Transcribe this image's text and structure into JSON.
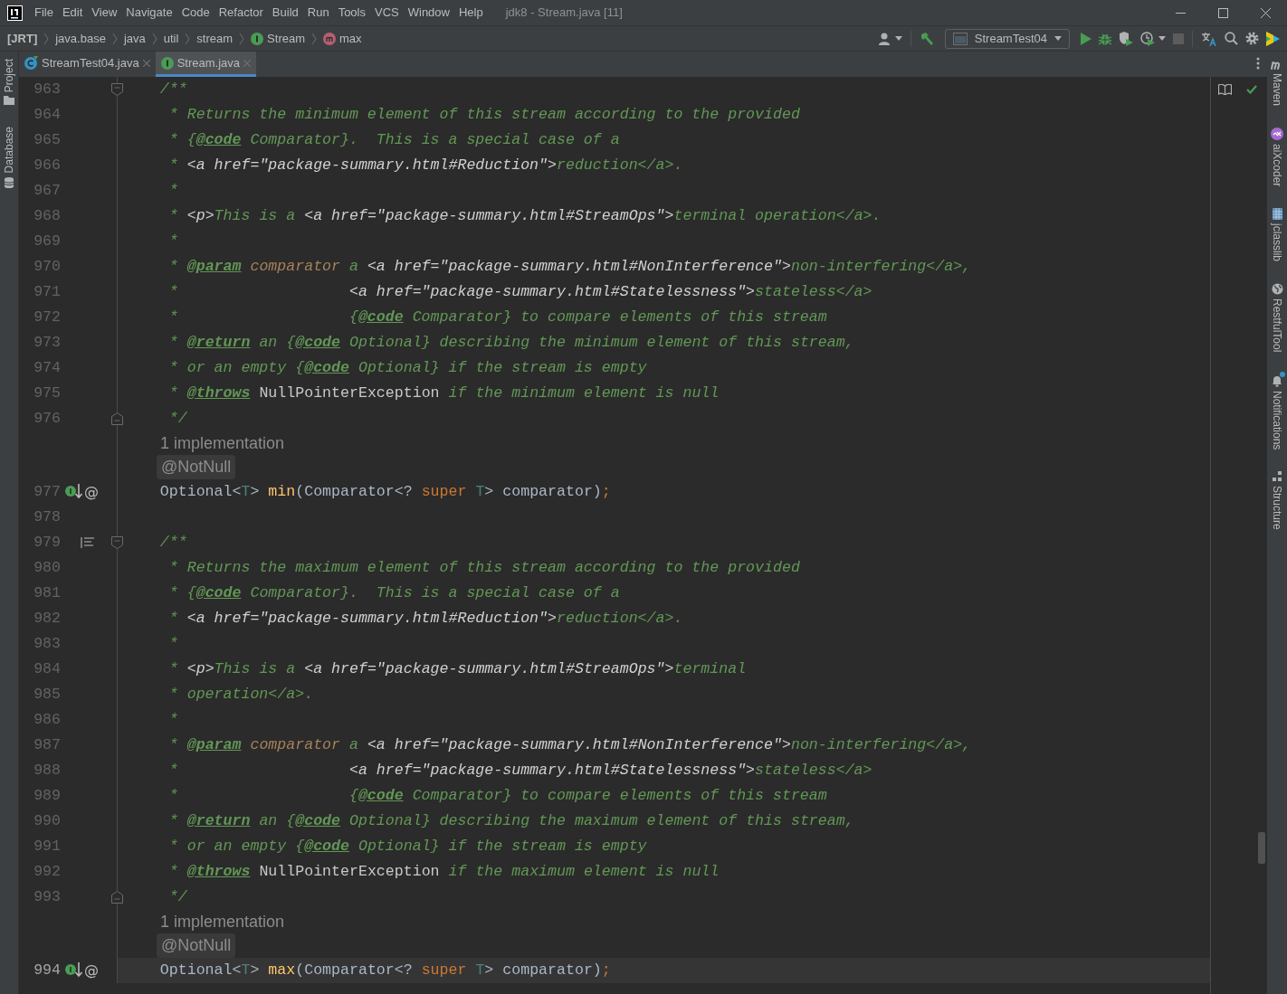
{
  "window": {
    "title": "jdk8 - Stream.java [11]"
  },
  "menu": [
    {
      "label": "File"
    },
    {
      "label": "Edit"
    },
    {
      "label": "View"
    },
    {
      "label": "Navigate"
    },
    {
      "label": "Code"
    },
    {
      "label": "Refactor"
    },
    {
      "label": "Build"
    },
    {
      "label": "Run"
    },
    {
      "label": "Tools"
    },
    {
      "label": "VCS"
    },
    {
      "label": "Window"
    },
    {
      "label": "Help"
    }
  ],
  "breadcrumbs": [
    {
      "label": "[JRT]",
      "kind": "module"
    },
    {
      "label": "java.base",
      "kind": "package"
    },
    {
      "label": "java",
      "kind": "package"
    },
    {
      "label": "util",
      "kind": "package"
    },
    {
      "label": "stream",
      "kind": "package"
    },
    {
      "label": "Stream",
      "kind": "interface"
    },
    {
      "label": "max",
      "kind": "method"
    }
  ],
  "toolbar": {
    "run_configuration": "StreamTest04",
    "stop_disabled": true
  },
  "tabs": [
    {
      "label": "StreamTest04.java",
      "kind": "class",
      "selected": false
    },
    {
      "label": "Stream.java",
      "kind": "interface",
      "selected": true
    }
  ],
  "left_tools": [
    {
      "label": "Project",
      "kind": "folder"
    },
    {
      "label": "Database",
      "kind": "database"
    }
  ],
  "right_tools": [
    {
      "label": "Maven",
      "kind": "maven",
      "badge": false
    },
    {
      "label": "aiXcoder",
      "kind": "plugin",
      "badge": false
    },
    {
      "label": "jclasslib",
      "kind": "grid",
      "badge": false
    },
    {
      "label": "RestfulTool",
      "kind": "globe",
      "badge": false
    },
    {
      "label": "Notifications",
      "kind": "bell",
      "badge": true
    },
    {
      "label": "Structure",
      "kind": "structure",
      "badge": false
    }
  ],
  "editor": {
    "rows": [
      {
        "kind": "code",
        "number": "963",
        "fold": {
          "kind": "start"
        },
        "current": false,
        "tokens": [
          {
            "kind": "doc",
            "text": "    /**"
          }
        ]
      },
      {
        "kind": "code",
        "number": "964",
        "current": false,
        "tokens": [
          {
            "kind": "doc",
            "text": "     * Returns the minimum element of this stream according to the provided"
          }
        ]
      },
      {
        "kind": "code",
        "number": "965",
        "current": false,
        "tokens": [
          {
            "kind": "doc",
            "text": "     * {"
          },
          {
            "kind": "tag",
            "text": "@code"
          },
          {
            "kind": "doc",
            "text": " Comparator}.  This is a special case of a"
          }
        ]
      },
      {
        "kind": "code",
        "number": "966",
        "current": false,
        "tokens": [
          {
            "kind": "doc",
            "text": "     * "
          },
          {
            "kind": "markup",
            "text": "<a href=\"package-summary.html#Reduction\">"
          },
          {
            "kind": "doc",
            "text": "reduction</a>."
          }
        ]
      },
      {
        "kind": "code",
        "number": "967",
        "current": false,
        "tokens": [
          {
            "kind": "doc",
            "text": "     *"
          }
        ]
      },
      {
        "kind": "code",
        "number": "968",
        "current": false,
        "tokens": [
          {
            "kind": "doc",
            "text": "     * "
          },
          {
            "kind": "markup",
            "text": "<p>"
          },
          {
            "kind": "doc",
            "text": "This is a "
          },
          {
            "kind": "markup",
            "text": "<a href=\"package-summary.html#StreamOps\">"
          },
          {
            "kind": "doc",
            "text": "terminal operation</a>."
          }
        ]
      },
      {
        "kind": "code",
        "number": "969",
        "current": false,
        "tokens": [
          {
            "kind": "doc",
            "text": "     *"
          }
        ]
      },
      {
        "kind": "code",
        "number": "970",
        "current": false,
        "tokens": [
          {
            "kind": "doc",
            "text": "     * "
          },
          {
            "kind": "tag",
            "text": "@param"
          },
          {
            "kind": "param",
            "text": " comparator"
          },
          {
            "kind": "doc",
            "text": " a "
          },
          {
            "kind": "markup",
            "text": "<a href=\"package-summary.html#NonInterference\">"
          },
          {
            "kind": "doc",
            "text": "non-interfering</a>,"
          }
        ]
      },
      {
        "kind": "code",
        "number": "971",
        "current": false,
        "tokens": [
          {
            "kind": "doc",
            "text": "     *                   "
          },
          {
            "kind": "markup",
            "text": "<a href=\"package-summary.html#Statelessness\">"
          },
          {
            "kind": "doc",
            "text": "stateless</a>"
          }
        ]
      },
      {
        "kind": "code",
        "number": "972",
        "current": false,
        "tokens": [
          {
            "kind": "doc",
            "text": "     *                   {"
          },
          {
            "kind": "tag",
            "text": "@code"
          },
          {
            "kind": "doc",
            "text": " Comparator} to compare elements of this stream"
          }
        ]
      },
      {
        "kind": "code",
        "number": "973",
        "current": false,
        "tokens": [
          {
            "kind": "doc",
            "text": "     * "
          },
          {
            "kind": "tag",
            "text": "@return"
          },
          {
            "kind": "doc",
            "text": " an {"
          },
          {
            "kind": "tag",
            "text": "@code"
          },
          {
            "kind": "doc",
            "text": " Optional} describing the minimum element of this stream,"
          }
        ]
      },
      {
        "kind": "code",
        "number": "974",
        "current": false,
        "tokens": [
          {
            "kind": "doc",
            "text": "     * or an empty {"
          },
          {
            "kind": "tag",
            "text": "@code"
          },
          {
            "kind": "doc",
            "text": " Optional} if the stream is empty"
          }
        ]
      },
      {
        "kind": "code",
        "number": "975",
        "current": false,
        "tokens": [
          {
            "kind": "doc",
            "text": "     * "
          },
          {
            "kind": "tag",
            "text": "@throws"
          },
          {
            "kind": "ref",
            "text": " NullPointerException"
          },
          {
            "kind": "doc",
            "text": " if the minimum element is null"
          }
        ]
      },
      {
        "kind": "code",
        "number": "976",
        "fold": {
          "kind": "end"
        },
        "current": false,
        "tokens": [
          {
            "kind": "doc",
            "text": "     */"
          }
        ]
      },
      {
        "kind": "hint",
        "text": "1 implementation"
      },
      {
        "kind": "annotation",
        "text": "@NotNull"
      },
      {
        "kind": "code",
        "number": "977",
        "current": false,
        "marks": [
          {
            "kind": "implemented"
          }
        ],
        "annotation_mark": "@",
        "tokens": [
          {
            "kind": "plain",
            "text": "    Optional<"
          },
          {
            "kind": "type",
            "text": "T"
          },
          {
            "kind": "plain",
            "text": "> "
          },
          {
            "kind": "method",
            "text": "min"
          },
          {
            "kind": "plain",
            "text": "(Comparator<? "
          },
          {
            "kind": "keyword",
            "text": "super"
          },
          {
            "kind": "type",
            "text": " T"
          },
          {
            "kind": "plain",
            "text": "> comparator)"
          },
          {
            "kind": "keyword",
            "text": ";"
          }
        ]
      },
      {
        "kind": "code",
        "number": "978",
        "current": false
      },
      {
        "kind": "code",
        "number": "979",
        "fold": {
          "kind": "start"
        },
        "current": false,
        "marks": [
          {
            "kind": "render_doc"
          }
        ],
        "tokens": [
          {
            "kind": "doc",
            "text": "    /**"
          }
        ]
      },
      {
        "kind": "code",
        "number": "980",
        "current": false,
        "tokens": [
          {
            "kind": "doc",
            "text": "     * Returns the maximum element of this stream according to the provided"
          }
        ]
      },
      {
        "kind": "code",
        "number": "981",
        "current": false,
        "tokens": [
          {
            "kind": "doc",
            "text": "     * {"
          },
          {
            "kind": "tag",
            "text": "@code"
          },
          {
            "kind": "doc",
            "text": " Comparator}.  This is a special case of a"
          }
        ]
      },
      {
        "kind": "code",
        "number": "982",
        "current": false,
        "tokens": [
          {
            "kind": "doc",
            "text": "     * "
          },
          {
            "kind": "markup",
            "text": "<a href=\"package-summary.html#Reduction\">"
          },
          {
            "kind": "doc",
            "text": "reduction</a>."
          }
        ]
      },
      {
        "kind": "code",
        "number": "983",
        "current": false,
        "tokens": [
          {
            "kind": "doc",
            "text": "     *"
          }
        ]
      },
      {
        "kind": "code",
        "number": "984",
        "current": false,
        "tokens": [
          {
            "kind": "doc",
            "text": "     * "
          },
          {
            "kind": "markup",
            "text": "<p>"
          },
          {
            "kind": "doc",
            "text": "This is a "
          },
          {
            "kind": "markup",
            "text": "<a href=\"package-summary.html#StreamOps\">"
          },
          {
            "kind": "doc",
            "text": "terminal"
          }
        ]
      },
      {
        "kind": "code",
        "number": "985",
        "current": false,
        "tokens": [
          {
            "kind": "doc",
            "text": "     * operation</a>."
          }
        ]
      },
      {
        "kind": "code",
        "number": "986",
        "current": false,
        "tokens": [
          {
            "kind": "doc",
            "text": "     *"
          }
        ]
      },
      {
        "kind": "code",
        "number": "987",
        "current": false,
        "tokens": [
          {
            "kind": "doc",
            "text": "     * "
          },
          {
            "kind": "tag",
            "text": "@param"
          },
          {
            "kind": "param",
            "text": " comparator"
          },
          {
            "kind": "doc",
            "text": " a "
          },
          {
            "kind": "markup",
            "text": "<a href=\"package-summary.html#NonInterference\">"
          },
          {
            "kind": "doc",
            "text": "non-interfering</a>,"
          }
        ]
      },
      {
        "kind": "code",
        "number": "988",
        "current": false,
        "tokens": [
          {
            "kind": "doc",
            "text": "     *                   "
          },
          {
            "kind": "markup",
            "text": "<a href=\"package-summary.html#Statelessness\">"
          },
          {
            "kind": "doc",
            "text": "stateless</a>"
          }
        ]
      },
      {
        "kind": "code",
        "number": "989",
        "current": false,
        "tokens": [
          {
            "kind": "doc",
            "text": "     *                   {"
          },
          {
            "kind": "tag",
            "text": "@code"
          },
          {
            "kind": "doc",
            "text": " Comparator} to compare elements of this stream"
          }
        ]
      },
      {
        "kind": "code",
        "number": "990",
        "current": false,
        "tokens": [
          {
            "kind": "doc",
            "text": "     * "
          },
          {
            "kind": "tag",
            "text": "@return"
          },
          {
            "kind": "doc",
            "text": " an {"
          },
          {
            "kind": "tag",
            "text": "@code"
          },
          {
            "kind": "doc",
            "text": " Optional} describing the maximum element of this stream,"
          }
        ]
      },
      {
        "kind": "code",
        "number": "991",
        "current": false,
        "tokens": [
          {
            "kind": "doc",
            "text": "     * or an empty {"
          },
          {
            "kind": "tag",
            "text": "@code"
          },
          {
            "kind": "doc",
            "text": " Optional} if the stream is empty"
          }
        ]
      },
      {
        "kind": "code",
        "number": "992",
        "current": false,
        "tokens": [
          {
            "kind": "doc",
            "text": "     * "
          },
          {
            "kind": "tag",
            "text": "@throws"
          },
          {
            "kind": "ref",
            "text": " NullPointerException"
          },
          {
            "kind": "doc",
            "text": " if the maximum element is null"
          }
        ]
      },
      {
        "kind": "code",
        "number": "993",
        "fold": {
          "kind": "end"
        },
        "current": false,
        "tokens": [
          {
            "kind": "doc",
            "text": "     */"
          }
        ]
      },
      {
        "kind": "hint",
        "text": "1 implementation"
      },
      {
        "kind": "annotation",
        "text": "@NotNull"
      },
      {
        "kind": "code",
        "number": "994",
        "current": true,
        "marks": [
          {
            "kind": "implemented"
          }
        ],
        "annotation_mark": "@",
        "tokens": [
          {
            "kind": "plain",
            "text": "    Optional<"
          },
          {
            "kind": "type",
            "text": "T"
          },
          {
            "kind": "plain",
            "text": "> "
          },
          {
            "kind": "method",
            "text": "max"
          },
          {
            "kind": "plain",
            "text": "(Comparator<? "
          },
          {
            "kind": "keyword",
            "text": "super"
          },
          {
            "kind": "type",
            "text": " T"
          },
          {
            "kind": "plain",
            "text": "> comparator)"
          },
          {
            "kind": "keyword",
            "text": ";"
          }
        ]
      }
    ]
  }
}
